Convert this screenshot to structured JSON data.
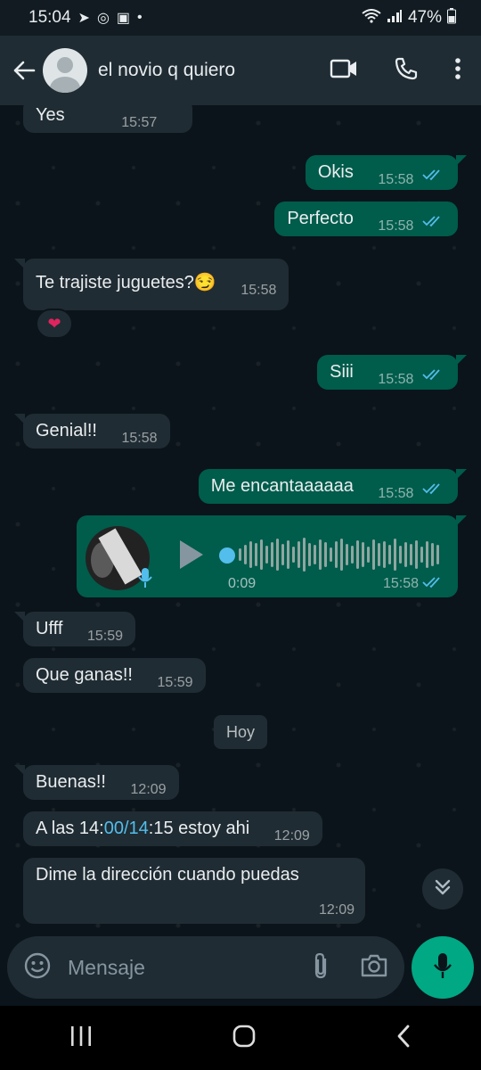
{
  "status_bar": {
    "time": "15:04",
    "battery": "47%"
  },
  "header": {
    "contact_name": "el novio q quiero"
  },
  "messages": [
    {
      "text": "Yes",
      "time": "15:57"
    },
    {
      "text": "Okis",
      "time": "15:58"
    },
    {
      "text": "Perfecto",
      "time": "15:58"
    },
    {
      "text": "Te trajiste juguetes?😏",
      "time": "15:58",
      "reaction": "❤"
    },
    {
      "text": "Siii",
      "time": "15:58"
    },
    {
      "text": "Genial!!",
      "time": "15:58"
    },
    {
      "text": "Me encantaaaaaa",
      "time": "15:58"
    },
    {
      "text": "Ufff",
      "time": "15:59"
    },
    {
      "text": "Que ganas!!",
      "time": "15:59"
    },
    {
      "text": "Buenas!!",
      "time": "12:09"
    },
    {
      "text_parts": [
        "A las 14:",
        "00/14",
        ":15 estoy ahi"
      ],
      "time": "12:09"
    },
    {
      "text": "Dime la dirección cuando puedas",
      "time": "12:09"
    }
  ],
  "voice_note": {
    "duration": "0:09",
    "time": "15:58"
  },
  "day_separator": "Hoy",
  "composer": {
    "placeholder": "Mensaje"
  },
  "colors": {
    "incoming": "#202c33",
    "outgoing": "#005c4b",
    "accent": "#00a884",
    "tick_read": "#53bdeb"
  },
  "icons": [
    "back-arrow-icon",
    "video-call-icon",
    "phone-icon",
    "more-icon",
    "emoji-icon",
    "attach-icon",
    "camera-icon",
    "mic-icon",
    "double-check-icon",
    "chevron-double-down-icon",
    "play-icon"
  ]
}
